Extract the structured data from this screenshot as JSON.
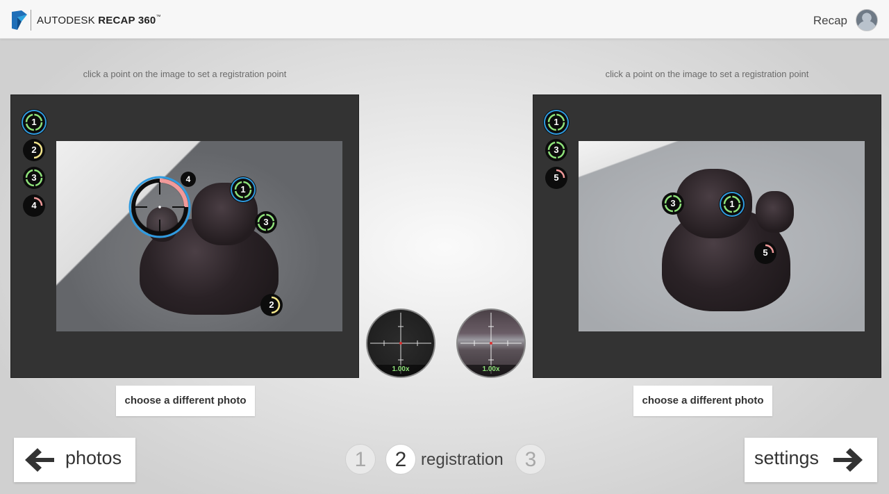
{
  "header": {
    "brand_light": "AUTODESK",
    "brand_bold": "RECAP 360",
    "brand_mark": "™",
    "user_name": "Recap"
  },
  "left_panel": {
    "hint": "click a point on the image to set a registration point",
    "legend": [
      "1",
      "2",
      "3",
      "4"
    ],
    "image_markers": [
      "1",
      "3",
      "2",
      "4"
    ],
    "choose_label": "choose a different photo"
  },
  "right_panel": {
    "hint": "click a point on the image to set a registration point",
    "legend": [
      "1",
      "3",
      "5"
    ],
    "image_markers": [
      "3",
      "1",
      "5"
    ],
    "choose_label": "choose a different photo"
  },
  "loupes": {
    "left_zoom": "1.00x",
    "right_zoom": "1.00x"
  },
  "footer": {
    "back_label": "photos",
    "next_label": "settings",
    "steps": [
      "1",
      "2",
      "3"
    ],
    "current_step_label": "registration"
  },
  "colors": {
    "selected_ring": "#2f9be0",
    "green": "#8fe37a",
    "yellow": "#f3e58a",
    "pink": "#f19a9a"
  },
  "icons": {
    "logo": "autodesk-logo-icon",
    "back": "arrow-left-icon",
    "next": "arrow-right-icon"
  }
}
